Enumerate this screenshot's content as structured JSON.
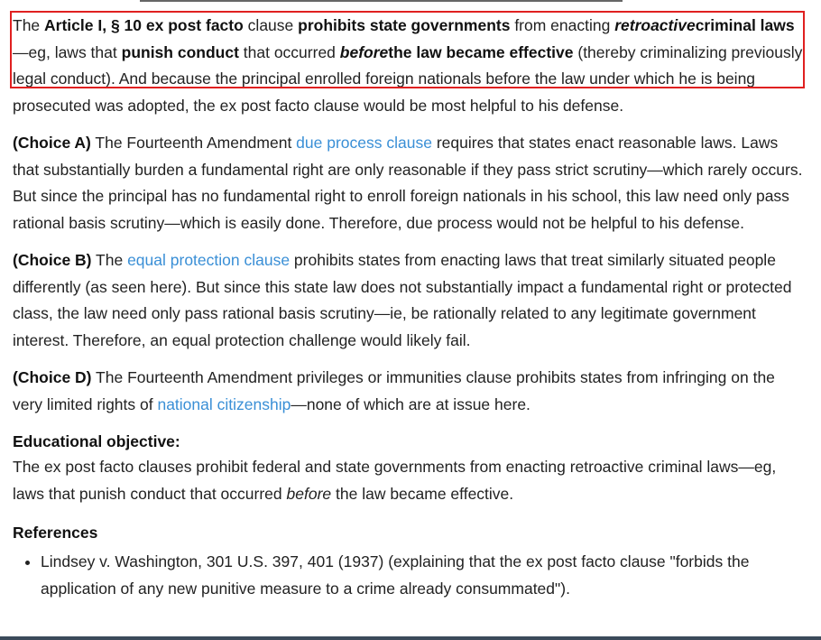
{
  "explanation": {
    "p1": {
      "s1": "The ",
      "b1": "Article I, § 10 ex post facto",
      "s2": " clause ",
      "b2": "prohibits state governments",
      "s3": " from enacting ",
      "b3": "retroactive",
      "b4": "criminal laws",
      "s4": "—eg, laws that ",
      "b5": "punish conduct",
      "s5": " that occurred ",
      "b6": "before",
      "b7": "the law became effective",
      "s6": " (thereby criminalizing previously legal conduct).  And because the principal enrolled foreign nationals before the law under which he is being prosecuted was adopted, the ex post facto clause would be most helpful to his defense."
    },
    "choiceA": {
      "label": "(Choice A)",
      "s1": "  The Fourteenth Amendment ",
      "link": "due process clause",
      "s2": " requires that states enact reasonable laws.  Laws that substantially burden a fundamental right are only reasonable if they pass strict scrutiny—which rarely occurs.  But since the principal has no fundamental right to enroll foreign nationals in his school, this law need only pass rational basis scrutiny—which is easily done.  Therefore, due process would not be helpful to his defense."
    },
    "choiceB": {
      "label": "(Choice B)",
      "s1": "  The ",
      "link": "equal protection clause",
      "s2": " prohibits states from enacting laws that treat similarly situated people differently (as seen here).  But since this state law does not substantially impact a fundamental right or protected class, the law need only pass rational basis scrutiny—ie, be rationally related to any legitimate government interest.  Therefore, an equal protection challenge would likely fail."
    },
    "choiceD": {
      "label": "(Choice D)",
      "s1": "  The Fourteenth Amendment privileges or immunities clause prohibits states from infringing on the very limited rights of ",
      "link": "national citizenship",
      "s2": "—none of which are at issue here."
    },
    "objective": {
      "heading": "Educational objective:",
      "s1": "The ex post facto clauses prohibit federal and state governments from enacting retroactive criminal laws—eg, laws that punish conduct that occurred ",
      "em": "before",
      "s2": " the law became effective."
    },
    "references": {
      "heading": "References",
      "items": [
        "Lindsey v. Washington, 301 U.S. 397, 401 (1937) (explaining that the ex post facto clause \"forbids the application of any new punitive measure to a crime already consummated\")."
      ]
    }
  },
  "colors": {
    "link": "#3a8fd6",
    "highlight_border": "#e02020",
    "text": "#222222"
  }
}
